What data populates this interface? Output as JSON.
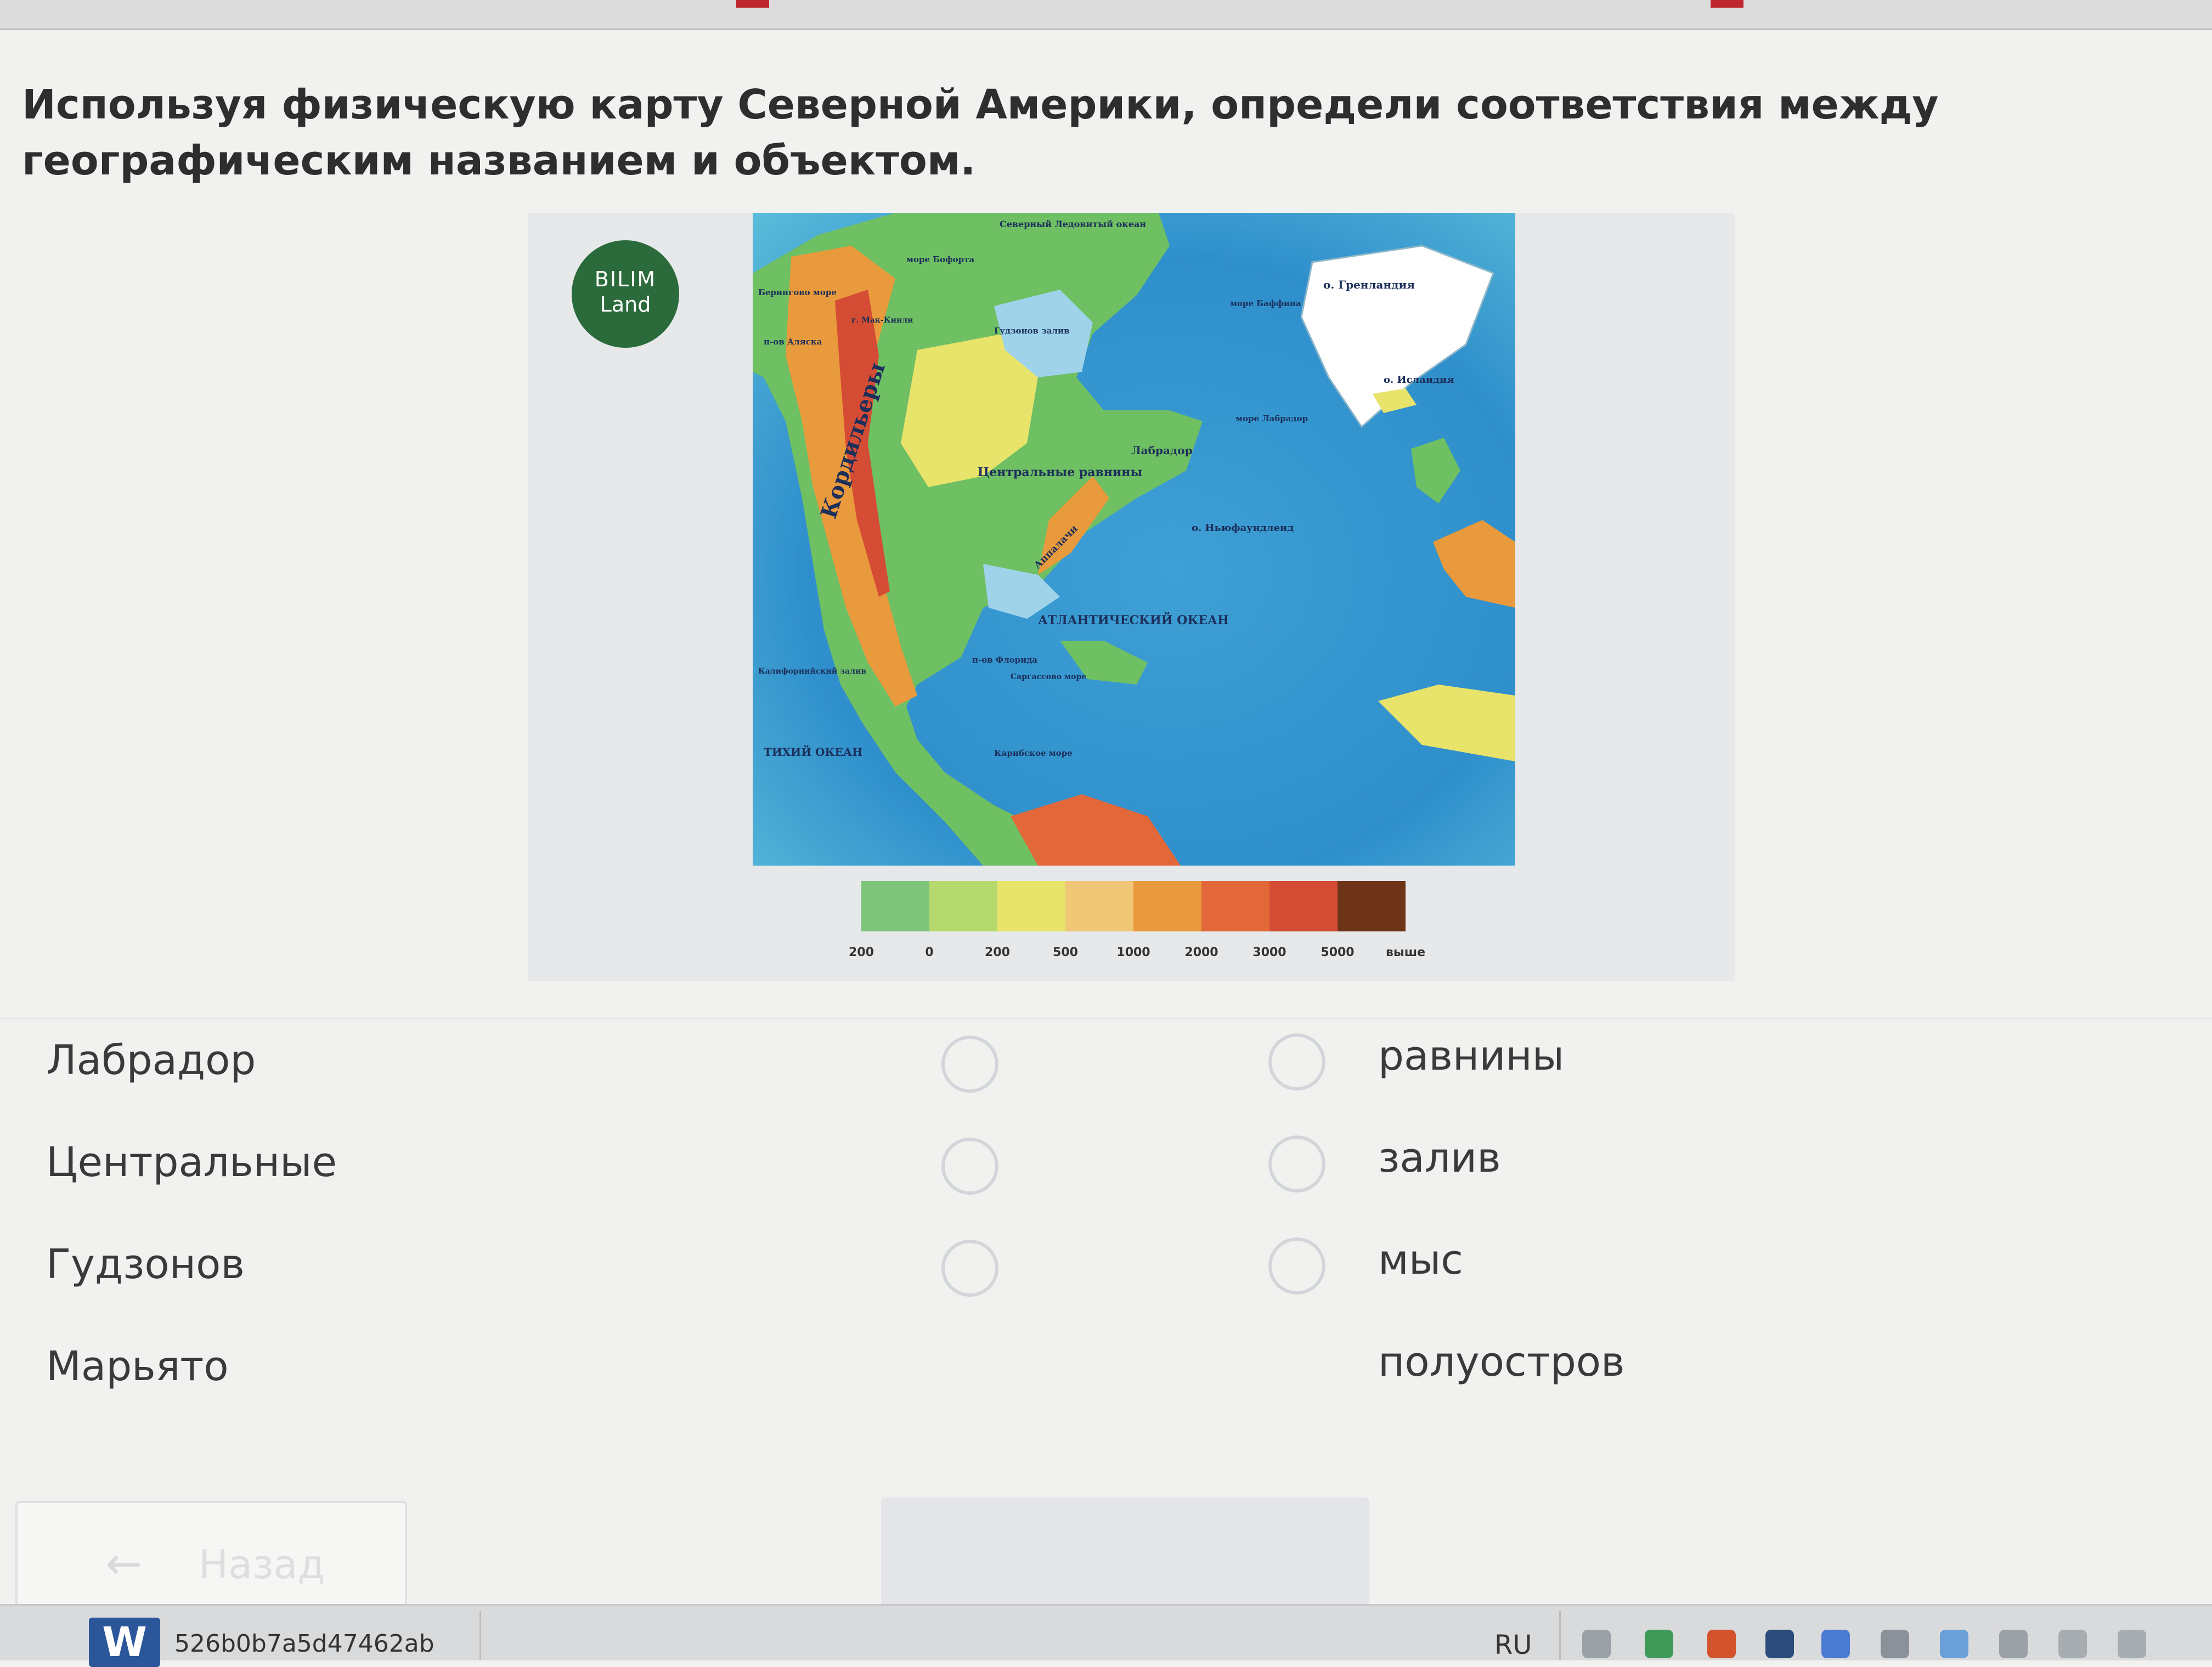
{
  "question": "Используя физическую карту Северной Америки, определи соответствия между географическим названием и объектом.",
  "logo": {
    "line1": "BILIM",
    "line2": "Land"
  },
  "map_labels": {
    "arctic": "Северный Ледовитый океан",
    "greenland": "о. Гренландия",
    "iceland": "о. Исландия",
    "labrador": "Лабрадор",
    "labrador_sea": "море Лабрадор",
    "newfoundland": "о. Ньюфаундленд",
    "central_plains": "Центральные равнины",
    "cordillera": "Кордильеры",
    "appalachians": "Аппалачи",
    "atlantic": "АТЛАНТИЧЕСКИЙ ОКЕАН",
    "pacific": "ТИХИЙ ОКЕАН",
    "hudson_bay": "Гудзонов залив",
    "beaufort_sea": "море Бофорта",
    "baffin_sea": "море Баффина",
    "bering_sea": "Берингово море",
    "alaska": "п-ов Аляска",
    "gulf_california": "Калифорнийский залив",
    "florida": "п-ов Флорида",
    "sargasso": "Саргассово море",
    "caribbean": "Карибское море",
    "mckinley": "г. Мак-Кинли"
  },
  "legend": {
    "labels": [
      "200",
      "0",
      "200",
      "500",
      "1000",
      "2000",
      "3000",
      "5000",
      "выше"
    ],
    "colors": [
      "#7ec47a",
      "#b6d96e",
      "#e8e36a",
      "#f0c776",
      "#e99a3c",
      "#e2683a",
      "#d54c34",
      "#6e3418"
    ]
  },
  "matching": {
    "left": [
      "Лабрадор",
      "Центральные",
      "Гудзонов",
      "Марьято"
    ],
    "right": [
      "равнины",
      "залив",
      "мыс",
      "полуостров"
    ]
  },
  "back_button": {
    "label": "Назад"
  },
  "taskbar": {
    "doc_name": "526b0b7a5d47462ab",
    "word_icon_letter": "W",
    "lang": "RU"
  }
}
